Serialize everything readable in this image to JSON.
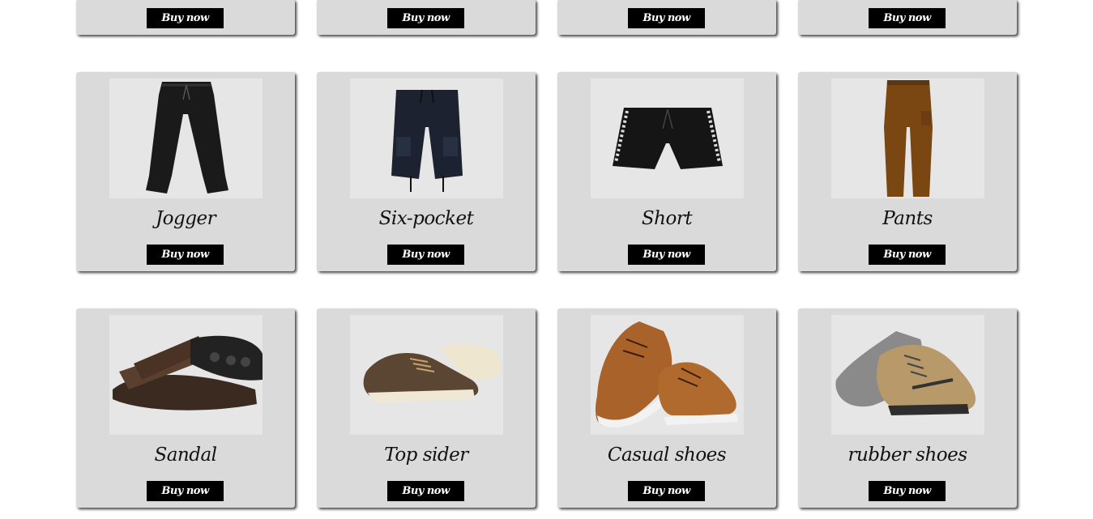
{
  "buy_label": "Buy now",
  "top_row": [
    {
      "button": "Buy now"
    },
    {
      "button": "Buy now"
    },
    {
      "button": "Buy now"
    },
    {
      "button": "Buy now"
    }
  ],
  "products": [
    {
      "name": "Jogger",
      "button": "Buy now",
      "image_icon": "jogger-icon",
      "color": "#1a1a1a"
    },
    {
      "name": "Six-pocket",
      "button": "Buy now",
      "image_icon": "cargo-shorts-icon",
      "color": "#1c2230"
    },
    {
      "name": "Short",
      "button": "Buy now",
      "image_icon": "shorts-icon",
      "color": "#151515"
    },
    {
      "name": "Pants",
      "button": "Buy now",
      "image_icon": "pants-icon",
      "color": "#7a4712"
    },
    {
      "name": "Sandal",
      "button": "Buy now",
      "image_icon": "sandal-icon",
      "color": "#3b2a20"
    },
    {
      "name": "Top sider",
      "button": "Buy now",
      "image_icon": "boat-shoe-icon",
      "color": "#5a4632"
    },
    {
      "name": "Casual shoes",
      "button": "Buy now",
      "image_icon": "casual-shoe-icon",
      "color": "#a8622a"
    },
    {
      "name": "rubber shoes",
      "button": "Buy now",
      "image_icon": "sneaker-icon",
      "color": "#b89a6a"
    }
  ]
}
